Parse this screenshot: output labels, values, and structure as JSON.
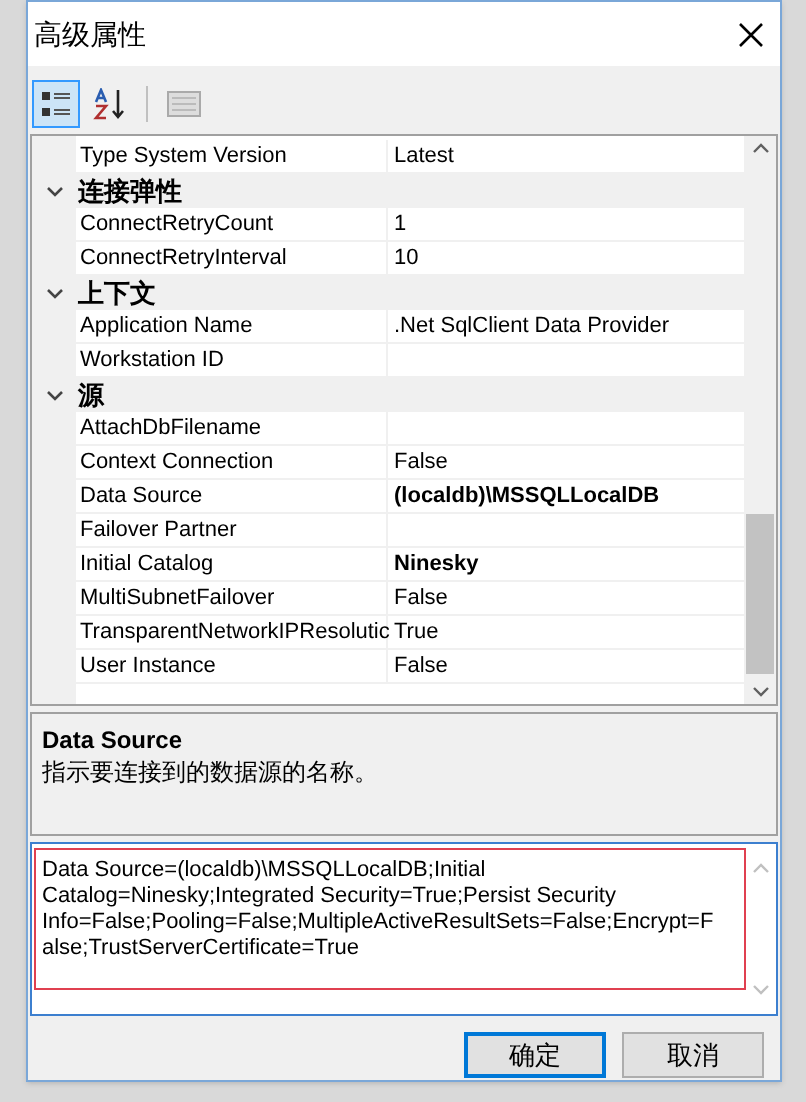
{
  "window": {
    "title": "高级属性"
  },
  "toolbar": [
    {
      "kind": "categorized",
      "selected": true
    },
    {
      "kind": "alphabetical",
      "selected": false
    },
    {
      "kind": "pages",
      "selected": false
    }
  ],
  "grid": [
    {
      "kind": "property",
      "name": "Type System Version",
      "value": "Latest",
      "bold": false
    },
    {
      "kind": "category",
      "name": "连接弹性",
      "expanded": true
    },
    {
      "kind": "property",
      "name": "ConnectRetryCount",
      "value": "1",
      "bold": false
    },
    {
      "kind": "property",
      "name": "ConnectRetryInterval",
      "value": "10",
      "bold": false
    },
    {
      "kind": "category",
      "name": "上下文",
      "expanded": true
    },
    {
      "kind": "property",
      "name": "Application Name",
      "value": ".Net SqlClient Data Provider",
      "bold": false
    },
    {
      "kind": "property",
      "name": "Workstation ID"
    },
    {
      "kind": "category",
      "name": "源",
      "expanded": true
    },
    {
      "kind": "property",
      "name": "AttachDbFilename"
    },
    {
      "kind": "property",
      "name": "Context Connection",
      "value": "False",
      "bold": false
    },
    {
      "kind": "property",
      "name": "Data Source",
      "value": "(localdb)\\MSSQLLocalDB",
      "bold": true
    },
    {
      "kind": "property",
      "name": "Failover Partner"
    },
    {
      "kind": "property",
      "name": "Initial Catalog",
      "value": "Ninesky",
      "bold": true
    },
    {
      "kind": "property",
      "name": "MultiSubnetFailover",
      "value": "False",
      "bold": false
    },
    {
      "kind": "property",
      "name": "TransparentNetworkIPResolutic",
      "value": "True",
      "bold": false
    },
    {
      "kind": "property",
      "name": "User Instance",
      "value": "False",
      "bold": false
    }
  ],
  "description": {
    "title": "Data Source",
    "text": "指示要连接到的数据源的名称。"
  },
  "connection_string": "Data Source=(localdb)\\MSSQLLocalDB;Initial Catalog=Ninesky;Integrated Security=True;Persist Security Info=False;Pooling=False;MultipleActiveResultSets=False;Encrypt=False;TrustServerCertificate=True",
  "buttons": [
    {
      "label": "确定",
      "default": true
    },
    {
      "label": "取消",
      "default": false
    }
  ]
}
